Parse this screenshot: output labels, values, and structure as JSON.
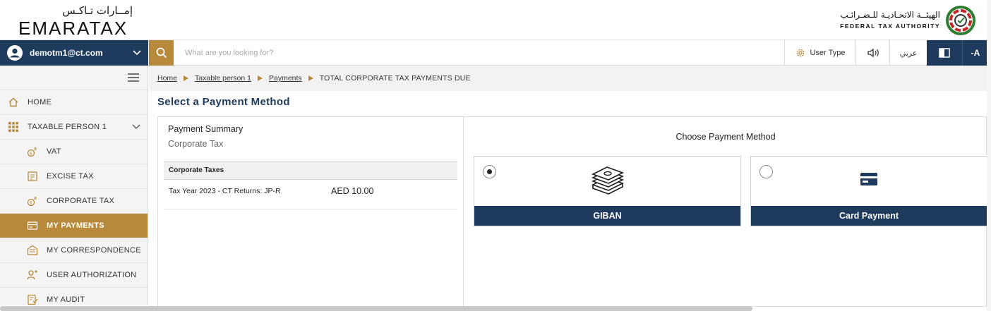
{
  "header": {
    "logo_ar": "إمــارات تـاكـس",
    "logo_en": "EMARATAX",
    "authority_ar": "الهيئــة الاتحـاديـة للـضـرائـب",
    "authority_en": "FEDERAL TAX AUTHORITY"
  },
  "topbar": {
    "user_email": "demotm1@ct.com",
    "search_placeholder": "What are you looking for?",
    "user_type_label": "User Type",
    "language_label": "عربي",
    "font_size_label": "-A"
  },
  "sidebar": {
    "items": [
      {
        "label": "HOME",
        "icon": "home-icon"
      },
      {
        "label": "TAXABLE PERSON 1",
        "icon": "grid-icon"
      },
      {
        "label": "VAT",
        "icon": "vat-icon"
      },
      {
        "label": "EXCISE TAX",
        "icon": "excise-tax-icon"
      },
      {
        "label": "CORPORATE TAX",
        "icon": "corporate-tax-icon"
      },
      {
        "label": "MY PAYMENTS",
        "icon": "payments-icon"
      },
      {
        "label": "MY CORRESPONDENCE",
        "icon": "correspondence-icon"
      },
      {
        "label": "USER AUTHORIZATION",
        "icon": "user-authorization-icon"
      },
      {
        "label": "MY AUDIT",
        "icon": "audit-icon"
      }
    ]
  },
  "breadcrumb": {
    "items": [
      "Home",
      "Taxable person 1",
      "Payments"
    ],
    "current": "TOTAL CORPORATE TAX PAYMENTS DUE"
  },
  "page": {
    "title": "Select a Payment Method"
  },
  "summary": {
    "title": "Payment Summary",
    "subtitle": "Corporate Tax",
    "table_header": "Corporate Taxes",
    "row_description": "Tax Year 2023 - CT Returns: JP-R",
    "row_amount": "AED 10.00"
  },
  "methods": {
    "heading": "Choose Payment Method",
    "options": [
      {
        "label": "GIBAN",
        "selected": true,
        "icon": "money-stack-icon"
      },
      {
        "label": "Card Payment",
        "selected": false,
        "icon": "credit-card-icon"
      }
    ]
  },
  "colors": {
    "navy": "#1e3a5c",
    "gold": "#b8893b"
  }
}
